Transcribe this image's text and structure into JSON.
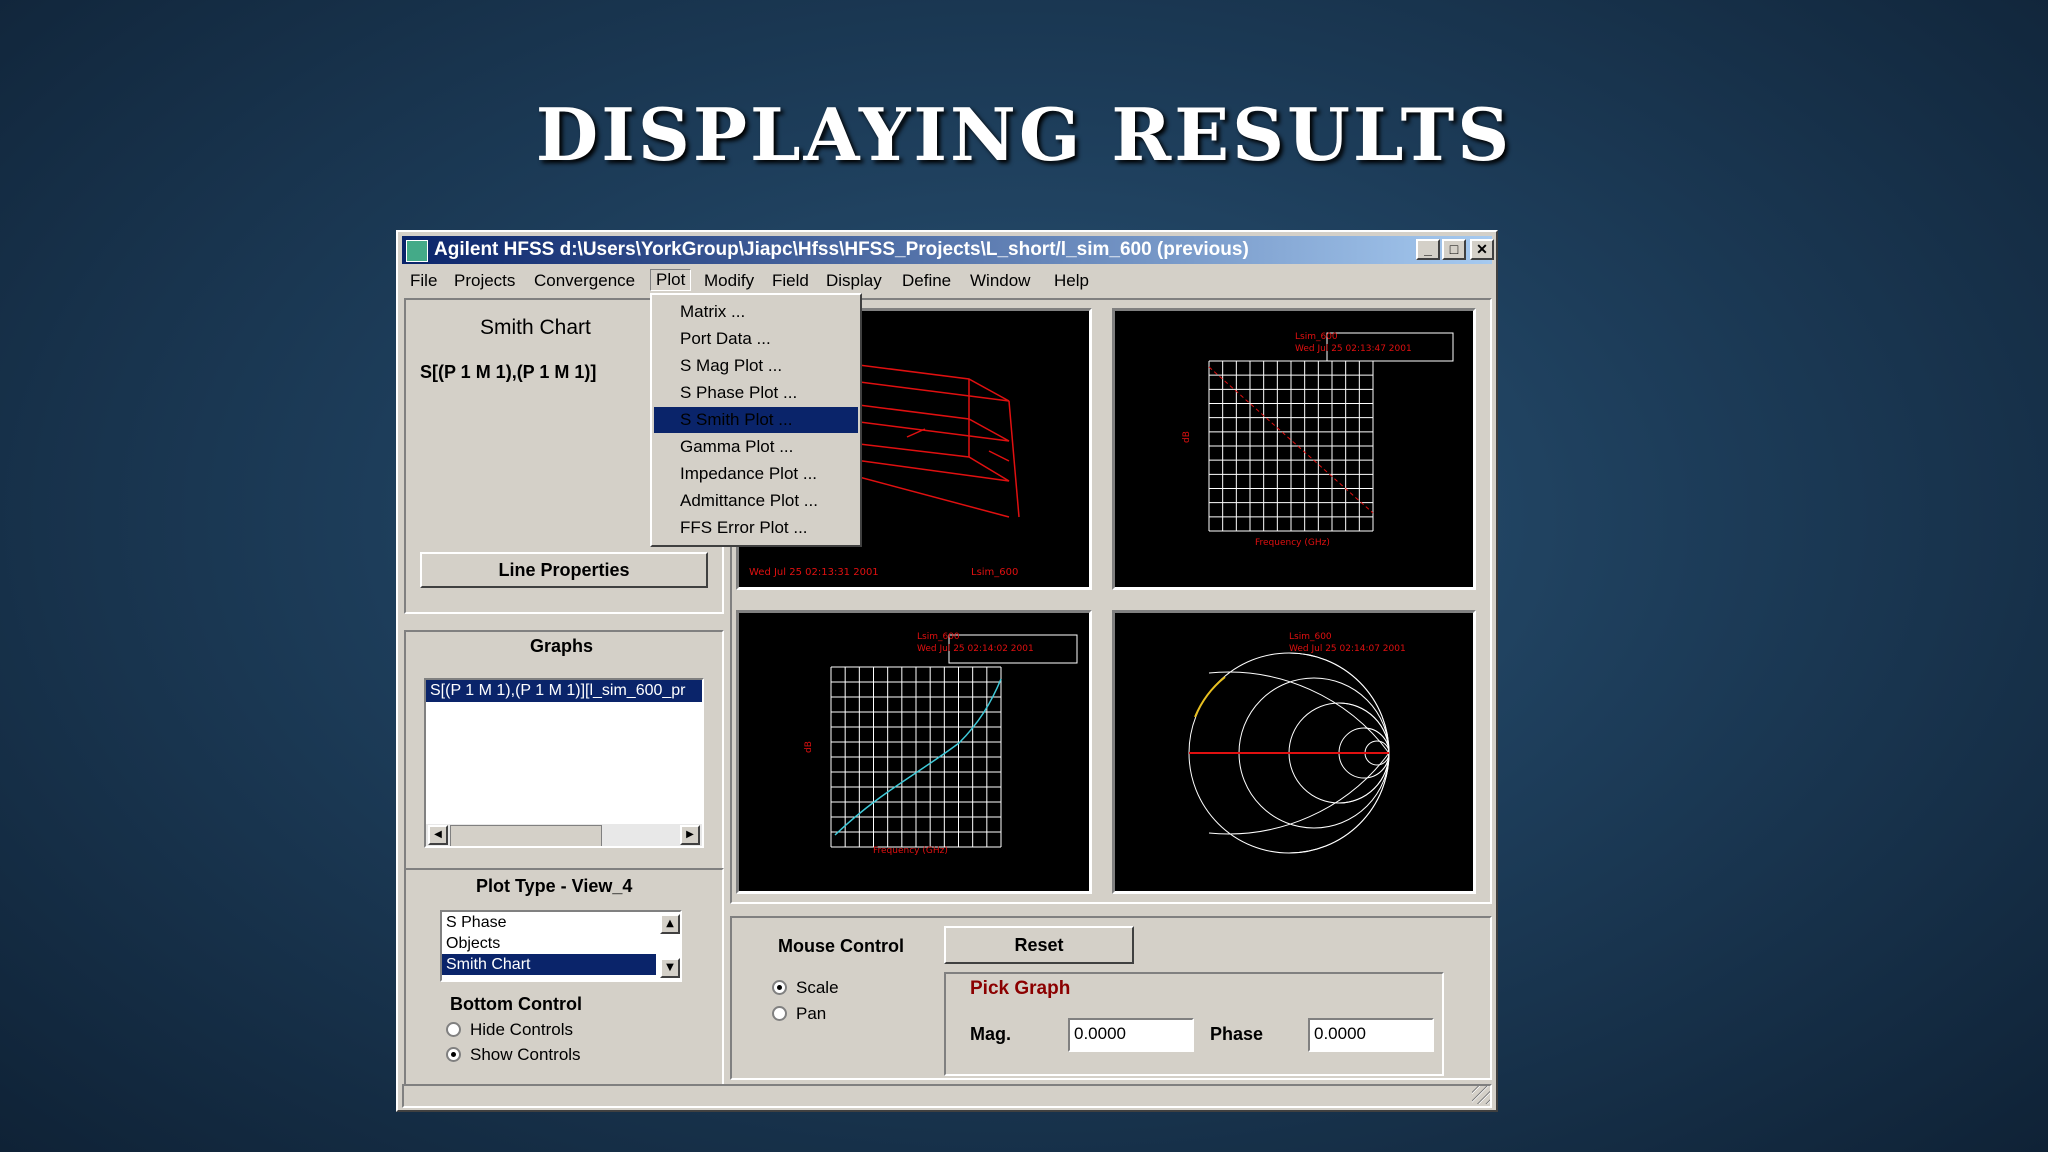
{
  "slide": {
    "title": "DISPLAYING RESULTS"
  },
  "window": {
    "title": "Agilent HFSS d:\\Users\\YorkGroup\\Jiapc\\Hfss\\HFSS_Projects\\L_short/l_sim_600 (previous)",
    "buttons": {
      "minimize": "_",
      "maximize": "□",
      "close": "✕"
    }
  },
  "menu": {
    "items": [
      "File",
      "Projects",
      "Convergence",
      "Plot",
      "Modify",
      "Field",
      "Display",
      "Define",
      "Window",
      "Help"
    ],
    "active": "Plot"
  },
  "plot_menu": {
    "items": [
      "Matrix ...",
      "Port Data ...",
      "S Mag Plot ...",
      "S Phase Plot ...",
      "S Smith Plot ...",
      "Gamma Plot ...",
      "Impedance Plot ...",
      "Admittance Plot ...",
      "FFS Error Plot ..."
    ],
    "highlighted": "S Smith Plot ..."
  },
  "left_panel": {
    "heading": "Smith Chart",
    "param": "S[(P 1 M 1),(P 1 M 1)]",
    "line_properties_button": "Line Properties"
  },
  "graphs_panel": {
    "heading": "Graphs",
    "items": [
      "S[(P 1 M 1),(P 1 M 1)][l_sim_600_pr"
    ]
  },
  "plot_type_panel": {
    "heading": "Plot Type - View_4",
    "options": [
      "S Phase",
      "Objects",
      "Smith Chart"
    ],
    "selected": "Smith Chart",
    "bottom_control_label": "Bottom Control",
    "hide_controls": "Hide Controls",
    "show_controls": "Show Controls",
    "bottom_control_selected": "Show Controls"
  },
  "graph_views": {
    "geometry": {
      "footer_left": "Wed Jul 25 02:13:31 2001",
      "footer_right": "Lsim_600"
    },
    "mag_plot": {
      "name": "Lsim_600",
      "timestamp": "Wed Jul 25 02:13:47 2001",
      "xlabel": "Frequency (GHz)",
      "ylabel": "dB"
    },
    "phase_plot": {
      "name": "Lsim_600",
      "timestamp": "Wed Jul 25 02:14:02 2001",
      "xlabel": "Frequency (GHz)",
      "ylabel": "dB"
    },
    "smith_plot": {
      "name": "Lsim_600",
      "timestamp": "Wed Jul 25 02:14:07 2001"
    }
  },
  "mouse_control": {
    "label": "Mouse Control",
    "reset_button": "Reset",
    "scale": "Scale",
    "pan": "Pan",
    "selected": "Scale"
  },
  "pick_graph": {
    "title": "Pick Graph",
    "mag_label": "Mag.",
    "mag_value": "0.0000",
    "phase_label": "Phase",
    "phase_value": "0.0000"
  },
  "colors": {
    "title_bar": "#0a246a",
    "plot_red": "#e01010",
    "plot_cyan": "#3fc9d8",
    "pick_graph_text": "#8b0000"
  }
}
